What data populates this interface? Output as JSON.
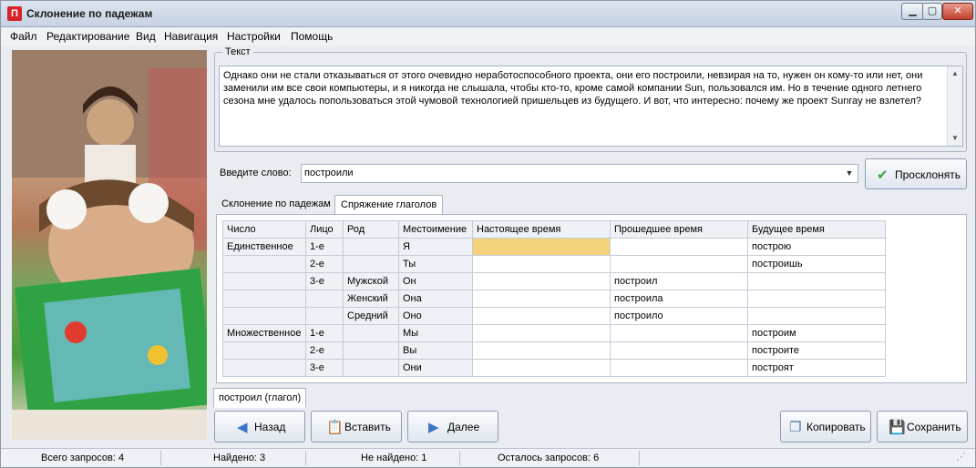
{
  "window": {
    "title": "Склонение по падежам",
    "app_icon_glyph": "П"
  },
  "menu": [
    "Файл",
    "Редактирование",
    "Вид",
    "Навигация",
    "Настройки",
    "Помощь"
  ],
  "text_group": {
    "label": "Текст",
    "content": "Однако они не стали отказываться от этого очевидно неработоспособного проекта, они его построили, невзирая на то, нужен он кому-то или нет, они заменили им все свои компьютеры, и я никогда не слышала, чтобы кто-то, кроме самой компании Sun, пользовался им. Но в течение одного летнего сезона мне удалось попользоваться этой чумовой технологией пришельцев из будущего. И вот, что интересно: почему же проект Sunray не взлетел?"
  },
  "word": {
    "label": "Введите слово:",
    "value": "построили"
  },
  "buttons": {
    "decline": "Просклонять",
    "back": "Назад",
    "paste": "Вставить",
    "next": "Далее",
    "copy": "Копировать",
    "save": "Сохранить"
  },
  "tabs": [
    "Склонение по падежам",
    "Спряжение глаголов"
  ],
  "active_tab": "Спряжение глаголов",
  "table": {
    "headers": [
      "Число",
      "Лицо",
      "Род",
      "Местоимение",
      "Настоящее время",
      "Прошедшее время",
      "Будущее время"
    ],
    "rows": [
      [
        "Единственное",
        "1-е",
        "",
        "Я",
        "",
        "",
        "построю"
      ],
      [
        "",
        "2-е",
        "",
        "Ты",
        "",
        "",
        "построишь"
      ],
      [
        "",
        "3-е",
        "Мужской",
        "Он",
        "",
        "построил",
        ""
      ],
      [
        "",
        "",
        "Женский",
        "Она",
        "",
        "построила",
        ""
      ],
      [
        "",
        "",
        "Средний",
        "Оно",
        "",
        "построило",
        ""
      ],
      [
        "Множественное",
        "1-е",
        "",
        "Мы",
        "",
        "",
        "построим"
      ],
      [
        "",
        "2-е",
        "",
        "Вы",
        "",
        "",
        "построите"
      ],
      [
        "",
        "3-е",
        "",
        "Они",
        "",
        "",
        "построят"
      ]
    ]
  },
  "result_tab": "построил (глагол)",
  "status": {
    "total": "Всего запросов: 4",
    "found": "Найдено: 3",
    "not_found": "Не найдено: 1",
    "remaining": "Осталось запросов: 6"
  },
  "colors": {
    "selected_cell": "#f3d27a",
    "close_button": "#c2412f"
  }
}
